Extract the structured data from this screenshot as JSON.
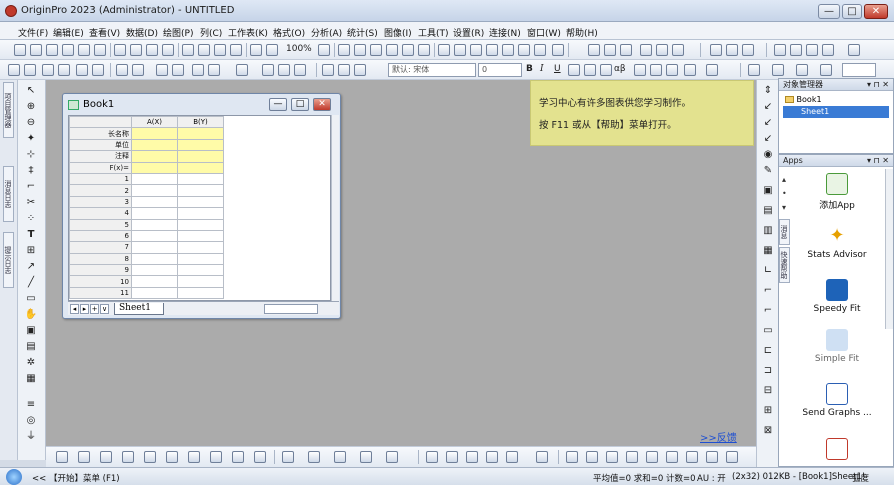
{
  "window": {
    "title": "OriginPro 2023 (Administrator) - UNTITLED",
    "min": "—",
    "max": "□",
    "close": "✕"
  },
  "menu": [
    "文件(F)",
    "编辑(E)",
    "查看(V)",
    "数据(D)",
    "绘图(P)",
    "列(C)",
    "工作表(K)",
    "格式(O)",
    "分析(A)",
    "统计(S)",
    "图像(I)",
    "工具(T)",
    "设置(R)",
    "连接(N)",
    "窗口(W)",
    "帮助(H)"
  ],
  "toolbar": {
    "zoom": "100%",
    "font_name": "默认: 宋体",
    "font_size": "0",
    "bold": "B",
    "italic": "I",
    "underline": "U",
    "alpha_beta": "αβ"
  },
  "left_tabs": [
    "项目管理器",
    "消息日志",
    "提示日志"
  ],
  "book1": {
    "title": "Book1",
    "columns": [
      "A(X)",
      "B(Y)"
    ],
    "meta_rows": [
      "长名称",
      "单位",
      "注释",
      "F(x)="
    ],
    "rows": [
      "1",
      "2",
      "3",
      "4",
      "5",
      "6",
      "7",
      "8",
      "9",
      "10",
      "11"
    ],
    "sheet_tab": "Sheet1",
    "nav_buttons": [
      "◂",
      "▸",
      "+",
      "∨"
    ]
  },
  "hint": {
    "line1": "学习中心有许多图表供您学习制作。",
    "line2": "按 F11 或从【帮助】菜单打开。"
  },
  "feedback_link": ">>反馈",
  "project_explorer": {
    "title": "对象管理器",
    "items": [
      "Book1",
      "Sheet1"
    ]
  },
  "apps": {
    "title": "Apps",
    "items": [
      "添加App",
      "Stats Advisor",
      "Speedy Fit",
      "Simple Fit",
      "Send Graphs ..."
    ]
  },
  "right_tabs": [
    "消息",
    "快速帮助"
  ],
  "status": {
    "left": "<< 【开始】菜单 (F1)",
    "stats": "平均值=0 求和=0 计数=0",
    "au": "AU : 开",
    "dims": "(2x32) 0",
    "mem": "12KB - [Book1]Sheet1!",
    "angle": "弧度"
  }
}
